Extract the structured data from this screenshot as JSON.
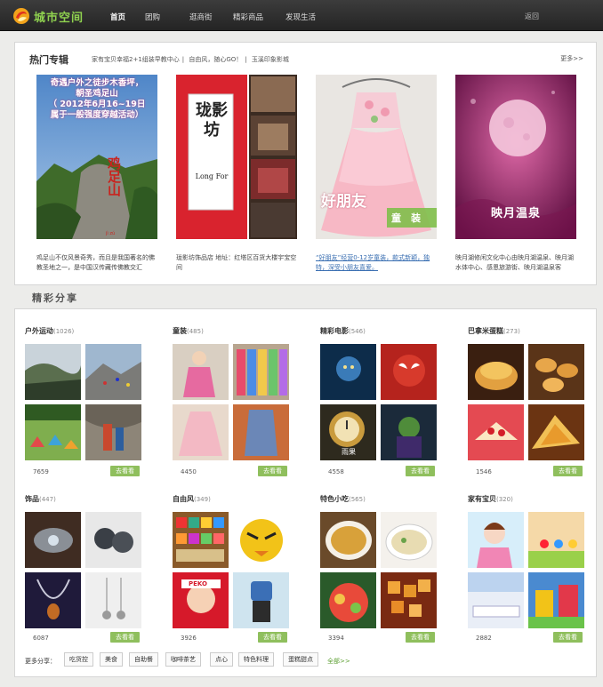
{
  "header": {
    "logo_text": "城市空间",
    "nav": [
      "首页",
      "团购",
      "逛商街",
      "精彩商品",
      "发现生活"
    ],
    "back": "返回"
  },
  "hot": {
    "title": "热门专辑",
    "links": [
      "家有宝贝幸福2+1组装早教中心",
      "自由风，随心GO！",
      "玉溪印象影城"
    ],
    "more": "更多>>",
    "items": [
      {
        "overlay": [
          "奇遇户外之徒步木香坪，",
          "朝圣鸡足山",
          "（ 2012年6月16~19日",
          "属于一般强度穿越活动）"
        ],
        "rock_text": "鸡足山",
        "rock_sub": "jì zú",
        "desc": "鸡足山不仅风景奇秀，而且是我国著名的佛教圣地之一，是中国汉传藏传佛教交汇"
      },
      {
        "logo_big": "珑影坊",
        "logo_en": "Long For",
        "desc": "珑影坊饰品店 地址：红塔区百货大楼宇宝空间"
      },
      {
        "overlay_a": "好朋友",
        "overlay_b": "童　装",
        "desc": "“好朋友”经营0-12岁童装，款式新颖，独特，深受小朋友喜爱。"
      },
      {
        "sign": "映月温泉",
        "desc": "映月湖修闲文化中心由映月湖温泉、映月湖水体中心、感恩旅游街、映月湖温泉客"
      }
    ]
  },
  "share": {
    "title": "精彩分享",
    "look": "去看看",
    "categories": [
      {
        "name": "户外运动",
        "count": "(1026)",
        "views": "7659"
      },
      {
        "name": "童装",
        "count": "(485)",
        "views": "4450"
      },
      {
        "name": "精彩电影",
        "count": "(546)",
        "views": "4558"
      },
      {
        "name": "巴拿米蛋糕",
        "count": "(273)",
        "views": "1546"
      },
      {
        "name": "饰品",
        "count": "(447)",
        "views": "6087"
      },
      {
        "name": "自由风",
        "count": "(349)",
        "views": "3926"
      },
      {
        "name": "特色小吃",
        "count": "(565)",
        "views": "3394"
      },
      {
        "name": "家有宝贝",
        "count": "(320)",
        "views": "2882"
      }
    ],
    "more_label": "更多分享：",
    "tags": [
      "吃货控",
      "美食",
      "自助餐",
      "咖啡茶艺",
      "点心",
      "特色料理",
      "蛋糕甜点"
    ],
    "all": "全部>>",
    "movie_caption": "雨果",
    "toy_caption": "PEKO"
  },
  "colors": {
    "accent": "#8fbf5d",
    "logo": "#8fd14f",
    "topbar": "#2e2e2e",
    "link": "#3a6fb2"
  }
}
